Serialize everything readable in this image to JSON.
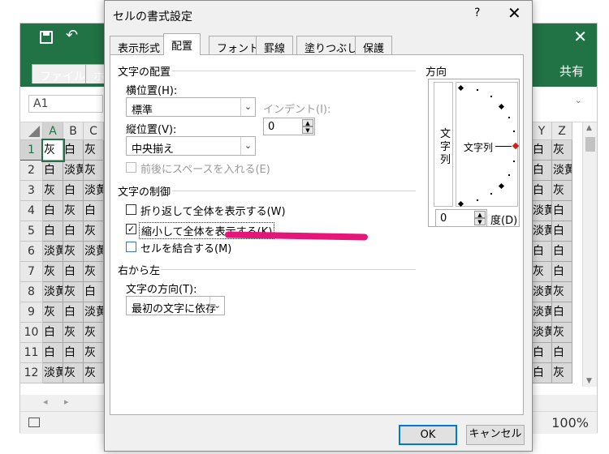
{
  "excel": {
    "ribbon_tabs": [
      "ファイル",
      "ホー"
    ],
    "share_label": "共有",
    "undo_glyph": "↶",
    "close_glyph": "✕",
    "name_box": "A1",
    "columns_left": [
      "A",
      "B",
      "C"
    ],
    "columns_right": [
      "Y",
      "Z"
    ],
    "rows": [
      "1",
      "2",
      "3",
      "4",
      "5",
      "6",
      "7",
      "8",
      "9",
      "10",
      "11",
      "12"
    ],
    "cells_left": [
      [
        "灰",
        "白",
        "灰"
      ],
      [
        "白",
        "淡黄",
        "灰"
      ],
      [
        "灰",
        "白",
        "淡黄"
      ],
      [
        "白",
        "灰",
        "白"
      ],
      [
        "白",
        "白",
        "灰"
      ],
      [
        "淡黄",
        "灰",
        "淡黄"
      ],
      [
        "灰",
        "白",
        "灰"
      ],
      [
        "淡黄",
        "灰",
        "白"
      ],
      [
        "灰",
        "白",
        "淡黄"
      ],
      [
        "白",
        "灰",
        "灰"
      ],
      [
        "白",
        "白",
        "灰"
      ],
      [
        "淡黄",
        "灰",
        "灰"
      ]
    ],
    "cells_right": [
      [
        "白",
        "灰"
      ],
      [
        "白",
        "淡黄"
      ],
      [
        "白",
        "灰"
      ],
      [
        "淡黄",
        "白"
      ],
      [
        "淡黄",
        "白"
      ],
      [
        "白",
        "白"
      ],
      [
        "灰",
        "白"
      ],
      [
        "淡黄",
        "灰"
      ],
      [
        "淡黄",
        "白"
      ],
      [
        "淡黄",
        "灰"
      ],
      [
        "白",
        "白"
      ],
      [
        "白",
        "灰"
      ]
    ],
    "nav_prev": "◂",
    "nav_next": "▸",
    "zoom": "100%"
  },
  "dialog": {
    "title": "セルの書式設定",
    "help": "?",
    "close": "✕",
    "tabs": [
      "表示形式",
      "配置",
      "フォント",
      "罫線",
      "塗りつぶし",
      "保護"
    ],
    "text_alignment_section": "文字の配置",
    "horizontal_label": "横位置(H):",
    "horizontal_value": "標準",
    "indent_label": "インデント(I):",
    "indent_value": "0",
    "vertical_label": "縦位置(V):",
    "vertical_value": "中央揃え",
    "justify_distributed": "前後にスペースを入れる(E)",
    "text_control_section": "文字の制御",
    "wrap_text": "折り返して全体を表示する(W)",
    "shrink_to_fit": "縮小して全体を表示する(K)",
    "merge_cells": "セルを結合する(M)",
    "checked_mark": "✓",
    "rtl_section": "右から左",
    "direction_label": "文字の方向(T):",
    "direction_value": "最初の文字に依存",
    "orientation_section": "方向",
    "vertical_text": [
      "文",
      "字",
      "列"
    ],
    "dial_text": "文字列",
    "degrees_value": "0",
    "degrees_label": "度(D)",
    "ok": "OK",
    "cancel": "キャンセル",
    "dropdown_glyph": "⌄",
    "spin_up": "▲",
    "spin_down": "▼"
  }
}
